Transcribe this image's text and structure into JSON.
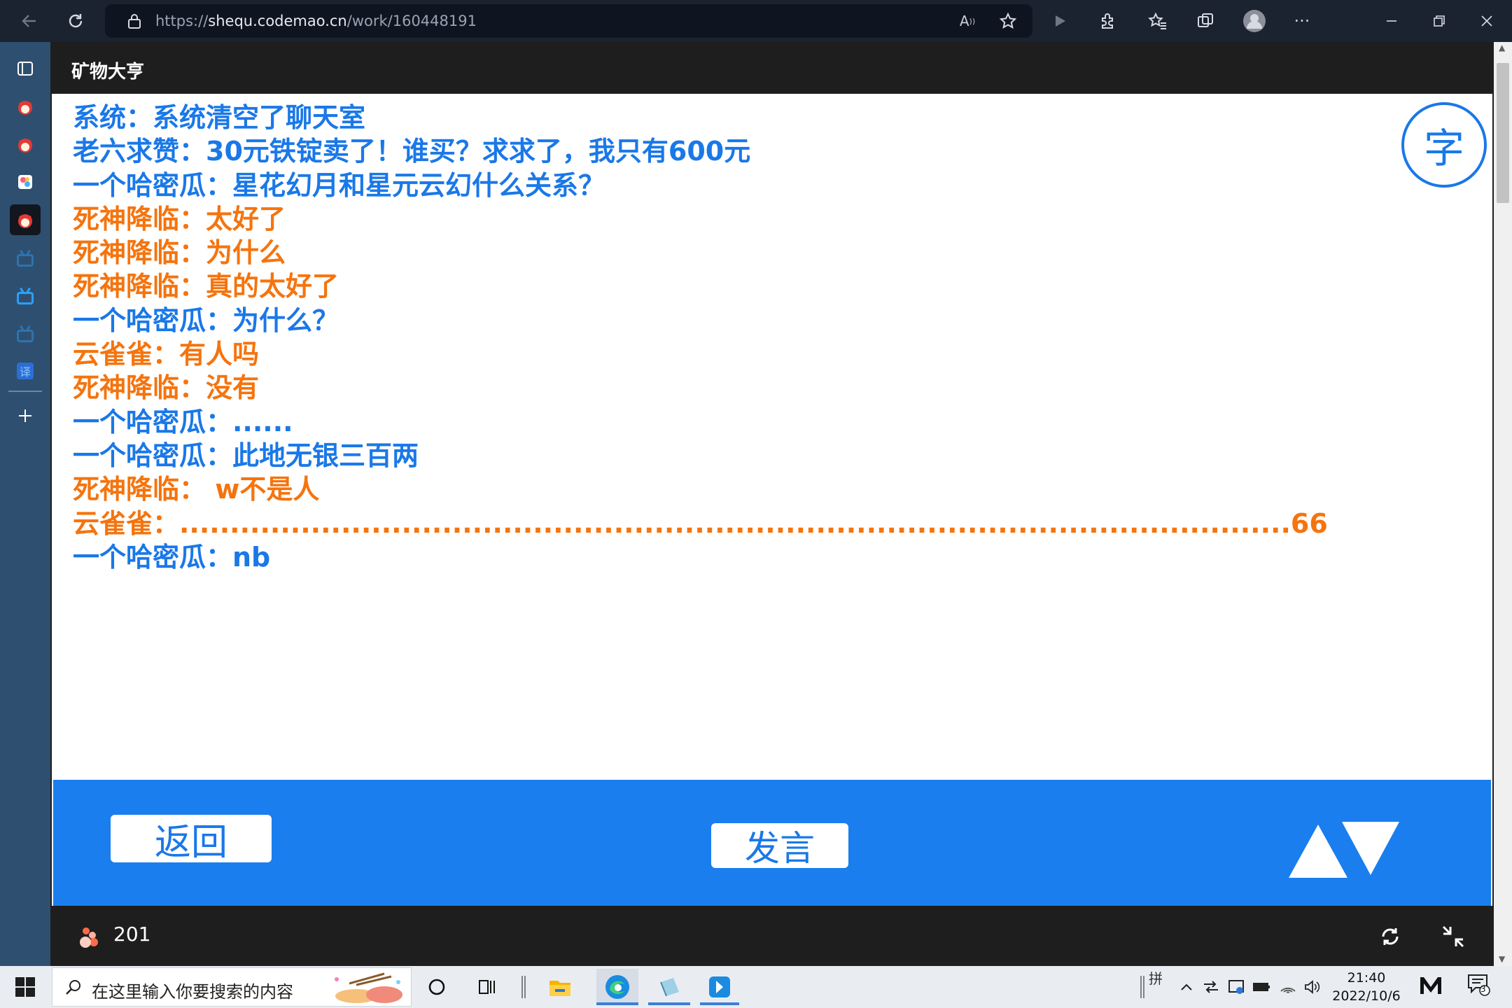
{
  "browser": {
    "url_prefix": "https://",
    "url_host": "shequ.codemao.cn",
    "url_path": "/work/160448191"
  },
  "page": {
    "title": "矿物大亨"
  },
  "chat": {
    "lines": [
      {
        "text": "系统：系统清空了聊天室",
        "color": "blue"
      },
      {
        "text": "老六求赞：30元铁锭卖了！谁买？求求了，我只有600元",
        "color": "blue"
      },
      {
        "text": "一个哈密瓜：星花幻月和星元云幻什么关系？",
        "color": "blue"
      },
      {
        "text": "死神降临：太好了",
        "color": "orange"
      },
      {
        "text": "死神降临：为什么",
        "color": "orange"
      },
      {
        "text": "死神降临：真的太好了",
        "color": "orange"
      },
      {
        "text": "一个哈密瓜：为什么？",
        "color": "blue"
      },
      {
        "text": "云雀雀：有人吗",
        "color": "orange"
      },
      {
        "text": "死神降临：没有",
        "color": "orange"
      },
      {
        "text": "一个哈密瓜：......",
        "color": "blue"
      },
      {
        "text": "一个哈密瓜：此地无银三百两",
        "color": "blue"
      },
      {
        "text": "死神降临： w不是人",
        "color": "orange"
      },
      {
        "text": "云雀雀：..............................................................................................................66",
        "color": "orange"
      },
      {
        "text": "一个哈密瓜：nb",
        "color": "blue"
      }
    ],
    "font_button": "字",
    "back_button": "返回",
    "speak_button": "发言"
  },
  "player": {
    "like_count": "201"
  },
  "taskbar": {
    "search_placeholder": "在这里输入你要搜索的内容",
    "ime": "拼",
    "time": "21:40",
    "date": "2022/10/6",
    "notification_count": "3"
  },
  "colors": {
    "chat_blue": "#1a78e8",
    "chat_orange": "#f5740e",
    "panel_blue": "#1a7eee"
  }
}
